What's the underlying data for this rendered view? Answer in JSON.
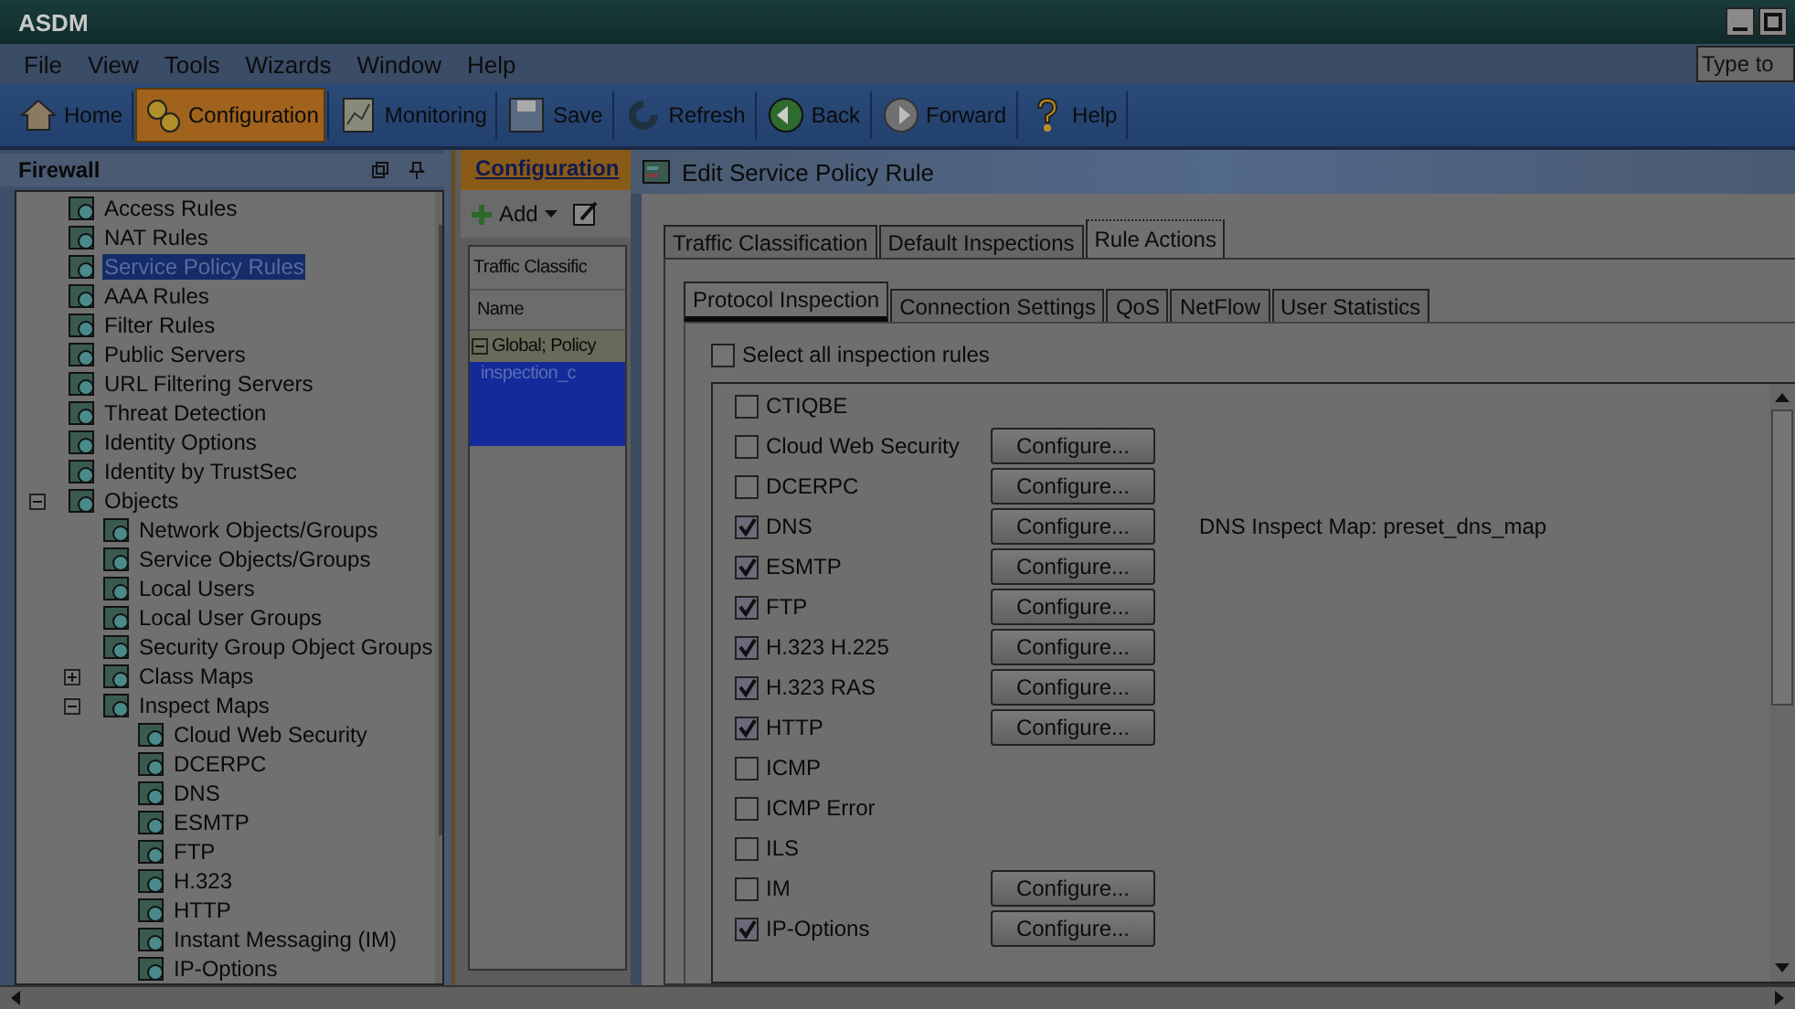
{
  "window": {
    "title": "ASDM"
  },
  "menu": [
    "File",
    "View",
    "Tools",
    "Wizards",
    "Window",
    "Help"
  ],
  "search": {
    "placeholder": "Type to"
  },
  "toolbar": [
    {
      "label": "Home",
      "kind": "home",
      "selected": false
    },
    {
      "label": "Configuration",
      "kind": "gears",
      "selected": true
    },
    {
      "label": "Monitoring",
      "kind": "chart",
      "selected": false
    },
    {
      "label": "Save",
      "kind": "disk",
      "selected": false
    },
    {
      "label": "Refresh",
      "kind": "refresh",
      "selected": false
    },
    {
      "label": "Back",
      "kind": "back",
      "selected": false
    },
    {
      "label": "Forward",
      "kind": "forward",
      "selected": false
    },
    {
      "label": "Help",
      "kind": "help",
      "selected": false
    }
  ],
  "sidebar": {
    "title": "Firewall",
    "items": [
      {
        "label": "Access Rules",
        "selected": false
      },
      {
        "label": "NAT Rules",
        "selected": false
      },
      {
        "label": "Service Policy Rules",
        "selected": true
      },
      {
        "label": "AAA Rules",
        "selected": false
      },
      {
        "label": "Filter Rules",
        "selected": false
      },
      {
        "label": "Public Servers",
        "selected": false
      },
      {
        "label": "URL Filtering Servers",
        "selected": false
      },
      {
        "label": "Threat Detection",
        "selected": false
      },
      {
        "label": "Identity Options",
        "selected": false
      },
      {
        "label": "Identity by TrustSec",
        "selected": false
      },
      {
        "label": "Objects",
        "selected": false,
        "expanded": true,
        "children": [
          {
            "label": "Network Objects/Groups",
            "selected": false
          },
          {
            "label": "Service Objects/Groups",
            "selected": false
          },
          {
            "label": "Local Users",
            "selected": false
          },
          {
            "label": "Local User Groups",
            "selected": false
          },
          {
            "label": "Security Group Object Groups",
            "selected": false
          },
          {
            "label": "Class Maps",
            "selected": false,
            "expanded": false
          },
          {
            "label": "Inspect Maps",
            "selected": false,
            "expanded": true,
            "children": [
              {
                "label": "Cloud Web Security",
                "selected": false
              },
              {
                "label": "DCERPC",
                "selected": false
              },
              {
                "label": "DNS",
                "selected": false
              },
              {
                "label": "ESMTP",
                "selected": false
              },
              {
                "label": "FTP",
                "selected": false
              },
              {
                "label": "H.323",
                "selected": false
              },
              {
                "label": "HTTP",
                "selected": false
              },
              {
                "label": "Instant Messaging (IM)",
                "selected": false
              },
              {
                "label": "IP-Options",
                "selected": false
              }
            ]
          }
        ]
      }
    ]
  },
  "middle": {
    "tab": "Configuration",
    "add": "Add",
    "header": "Traffic Classific",
    "column": "Name",
    "group": "Global; Policy",
    "rows": [
      {
        "label": "inspection_c",
        "selected": true
      }
    ]
  },
  "dialog": {
    "title": "Edit Service Policy Rule",
    "tabs": [
      {
        "label": "Traffic Classification",
        "selected": false
      },
      {
        "label": "Default Inspections",
        "selected": false
      },
      {
        "label": "Rule Actions",
        "selected": true
      }
    ],
    "subtabs": [
      {
        "label": "Protocol Inspection",
        "selected": true
      },
      {
        "label": "Connection Settings",
        "selected": false
      },
      {
        "label": "QoS",
        "selected": false
      },
      {
        "label": "NetFlow",
        "selected": false
      },
      {
        "label": "User Statistics",
        "selected": false
      }
    ],
    "select_all": {
      "label": "Select all inspection rules",
      "checked": false
    },
    "rules": [
      {
        "label": "CTIQBE",
        "checked": false
      },
      {
        "label": "Cloud Web Security",
        "checked": false,
        "button": "Configure..."
      },
      {
        "label": "DCERPC",
        "checked": false,
        "button": "Configure..."
      },
      {
        "label": "DNS",
        "checked": true,
        "button": "Configure...",
        "note": "DNS Inspect Map: preset_dns_map"
      },
      {
        "label": "ESMTP",
        "checked": true,
        "button": "Configure..."
      },
      {
        "label": "FTP",
        "checked": true,
        "button": "Configure..."
      },
      {
        "label": "H.323 H.225",
        "checked": true,
        "button": "Configure..."
      },
      {
        "label": "H.323 RAS",
        "checked": true,
        "button": "Configure..."
      },
      {
        "label": "HTTP",
        "checked": true,
        "button": "Configure..."
      },
      {
        "label": "ICMP",
        "checked": false
      },
      {
        "label": "ICMP Error",
        "checked": false
      },
      {
        "label": "ILS",
        "checked": false
      },
      {
        "label": "IM",
        "checked": false,
        "button": "Configure..."
      },
      {
        "label": "IP-Options",
        "checked": true,
        "button": "Configure..."
      }
    ]
  }
}
